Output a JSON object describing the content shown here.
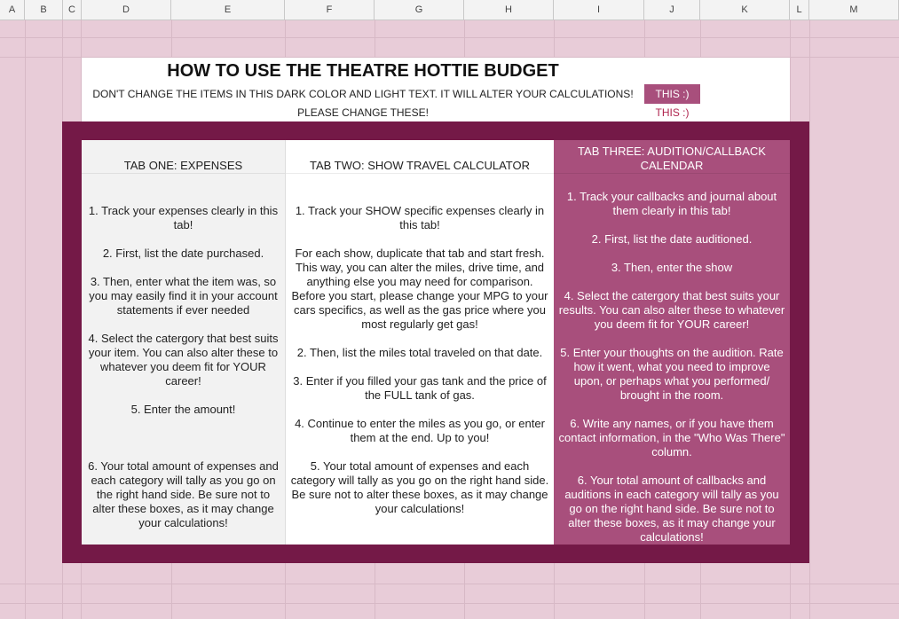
{
  "columns": [
    "",
    "A",
    "B",
    "C",
    "D",
    "E",
    "F",
    "G",
    "H",
    "I",
    "J",
    "K",
    "L",
    "M"
  ],
  "header": {
    "title": "HOW TO USE THE THEATRE HOTTIE BUDGET",
    "row1_text": "DON'T CHANGE THE ITEMS IN THIS DARK COLOR AND LIGHT TEXT. IT WILL ALTER YOUR CALCULATIONS!",
    "row1_tag": "THIS :)",
    "row2_text": "PLEASE CHANGE THESE!",
    "row2_tag": "THIS :)"
  },
  "colors": {
    "frame": "#741947",
    "dark_cell": "#a84f7c",
    "background": "#e8ccd8"
  },
  "tabs": [
    {
      "title": "TAB ONE: EXPENSES",
      "steps": [
        "1. Track your expenses clearly in this tab!",
        "2. First, list the date purchased.",
        "3. Then, enter what the item was, so you may easily find it in your account statements if ever needed",
        "4. Select the catergory that best suits your item. You can also alter these to whatever you deem fit for YOUR career!",
        "5. Enter the amount!",
        "",
        "6. Your total amount of expenses and each category will tally as you go on the right hand side. Be sure not to alter these boxes, as it may change your calculations!"
      ]
    },
    {
      "title": "TAB TWO: SHOW TRAVEL CALCULATOR",
      "steps": [
        "1. Track your SHOW specific expenses clearly in this tab!",
        "For each show, duplicate that tab and start fresh. This way, you can alter the miles, drive time, and anything else you may need for comparison.\nBefore you start, please change your MPG to your cars specifics, as well as the gas price where you most regularly get gas!",
        "2. Then, list the miles total traveled on that date.",
        "3. Enter if you filled your gas tank and the price of the FULL tank of gas.",
        "4. Continue to enter the miles as you go, or enter them at the end. Up to you!",
        "5. Your total amount of expenses and each category will tally as you go on the right hand side. Be sure not to alter these boxes, as it may change your calculations!"
      ]
    },
    {
      "title": "TAB THREE: AUDITION/CALLBACK CALENDAR",
      "steps": [
        "1. Track your callbacks and journal about them clearly in this tab!",
        "2. First, list the date auditioned.",
        "3. Then, enter the show",
        "4. Select the catergory that best suits your results. You can also alter these to whatever you deem fit for YOUR career!",
        "5. Enter your thoughts on the audition. Rate how it went, what you need to improve upon, or perhaps what you performed/ brought in the room.",
        "6. Write any names, or if you have them contact information, in the \"Who Was There\" column.",
        "6. Your total amount of callbacks and auditions in each category will tally as you go on the right hand side. Be sure not to alter these boxes, as it may change your calculations!"
      ]
    }
  ]
}
